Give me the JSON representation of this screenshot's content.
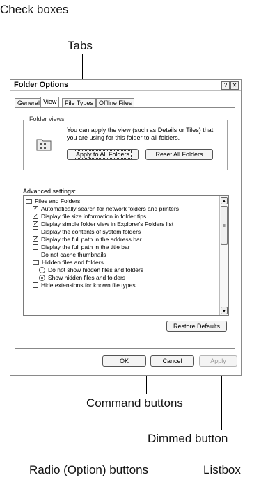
{
  "annotations": {
    "check_boxes": "Check boxes",
    "tabs": "Tabs",
    "command_buttons": "Command buttons",
    "dimmed_button": "Dimmed button",
    "radio_buttons": "Radio (Option) buttons",
    "listbox": "Listbox"
  },
  "dialog": {
    "title": "Folder Options",
    "help_glyph": "?",
    "close_glyph": "✕",
    "tabs": [
      "General",
      "View",
      "File Types",
      "Offline Files"
    ],
    "active_tab": "View",
    "folder_views": {
      "legend": "Folder views",
      "description": "You can apply the view (such as Details or Tiles) that you are using for this folder to all folders.",
      "apply_all_label": "Apply to All Folders",
      "reset_all_label": "Reset All Folders"
    },
    "advanced_label": "Advanced settings:",
    "list_items": [
      {
        "type": "folder",
        "label": "Files and Folders",
        "level": 0
      },
      {
        "type": "checkbox",
        "checked": true,
        "label": "Automatically search for network folders and printers",
        "level": 1
      },
      {
        "type": "checkbox",
        "checked": true,
        "label": "Display file size information in folder tips",
        "level": 1
      },
      {
        "type": "checkbox",
        "checked": true,
        "label": "Display simple folder view in Explorer's Folders list",
        "level": 1
      },
      {
        "type": "checkbox",
        "checked": false,
        "label": "Display the contents of system folders",
        "level": 1
      },
      {
        "type": "checkbox",
        "checked": true,
        "label": "Display the full path in the address bar",
        "level": 1
      },
      {
        "type": "checkbox",
        "checked": false,
        "label": "Display the full path in the title bar",
        "level": 1
      },
      {
        "type": "checkbox",
        "checked": false,
        "label": "Do not cache thumbnails",
        "level": 1
      },
      {
        "type": "folder",
        "label": "Hidden files and folders",
        "level": 1
      },
      {
        "type": "radio",
        "checked": false,
        "label": "Do not show hidden files and folders",
        "level": 2
      },
      {
        "type": "radio",
        "checked": true,
        "label": "Show hidden files and folders",
        "level": 2
      },
      {
        "type": "checkbox",
        "checked": false,
        "label": "Hide extensions for known file types",
        "level": 1
      }
    ],
    "restore_defaults_label": "Restore Defaults",
    "ok_label": "OK",
    "cancel_label": "Cancel",
    "apply_label": "Apply"
  }
}
